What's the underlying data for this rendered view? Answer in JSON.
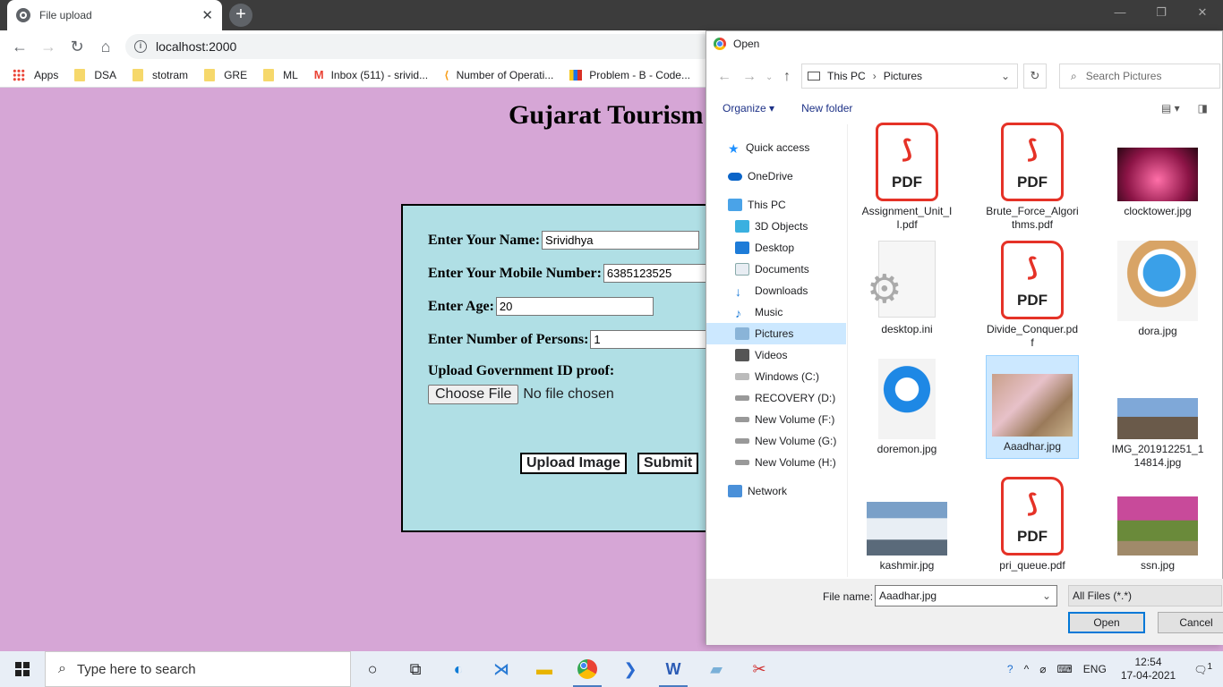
{
  "browser": {
    "tab_title": "File upload",
    "tab_close": "✕",
    "new_tab": "+",
    "url": "localhost:2000",
    "window_controls": [
      "—",
      "❐",
      "✕"
    ],
    "bookmarks": [
      "Apps",
      "DSA",
      "stotram",
      "GRE",
      "ML",
      "Inbox (511) - srivid...",
      "Number of Operati...",
      "Problem - B - Code..."
    ]
  },
  "page": {
    "title": "Gujarat Tourism",
    "form": {
      "name_label": "Enter Your Name:",
      "name_value": "Srividhya",
      "mobile_label": "Enter Your Mobile Number:",
      "mobile_value": "6385123525",
      "age_label": "Enter Age:",
      "age_value": "20",
      "persons_label": "Enter Number of Persons:",
      "persons_value": "1",
      "upload_label": "Upload Government ID proof:",
      "choose_file": "Choose File",
      "no_file": "No file chosen",
      "upload_button": "Upload Image",
      "submit_button": "Submit"
    }
  },
  "dialog": {
    "title": "Open",
    "path": [
      "This PC",
      "Pictures"
    ],
    "search_placeholder": "Search Pictures",
    "organize": "Organize",
    "new_folder": "New folder",
    "nav": {
      "quick_access": "Quick access",
      "onedrive": "OneDrive",
      "this_pc": "This PC",
      "objects3d": "3D Objects",
      "desktop": "Desktop",
      "documents": "Documents",
      "downloads": "Downloads",
      "music": "Music",
      "pictures": "Pictures",
      "videos": "Videos",
      "windows_c": "Windows (C:)",
      "recovery_d": "RECOVERY (D:)",
      "vol_f": "New Volume (F:)",
      "vol_g": "New Volume (G:)",
      "vol_h": "New Volume (H:)",
      "network": "Network"
    },
    "files": {
      "f1": "Assignment_Unit_II.pdf",
      "f2": "Brute_Force_Algorithms.pdf",
      "f3": "clocktower.jpg",
      "f4": "desktop.ini",
      "f5": "Divide_Conquer.pdf",
      "f6": "dora.jpg",
      "f7": "doremon.jpg",
      "f8": "Aaadhar.jpg",
      "f9": "IMG_201912251_114814.jpg",
      "f10": "kashmir.jpg",
      "f11": "pri_queue.pdf",
      "f12": "ssn.jpg"
    },
    "pdf_label": "PDF",
    "file_name_label": "File name:",
    "file_name_value": "Aaadhar.jpg",
    "filter": "All Files (*.*)",
    "open_button": "Open",
    "cancel_button": "Cancel"
  },
  "taskbar": {
    "search_placeholder": "Type here to search",
    "language": "ENG",
    "time": "12:54",
    "date": "17-04-2021",
    "notifications": "1"
  }
}
